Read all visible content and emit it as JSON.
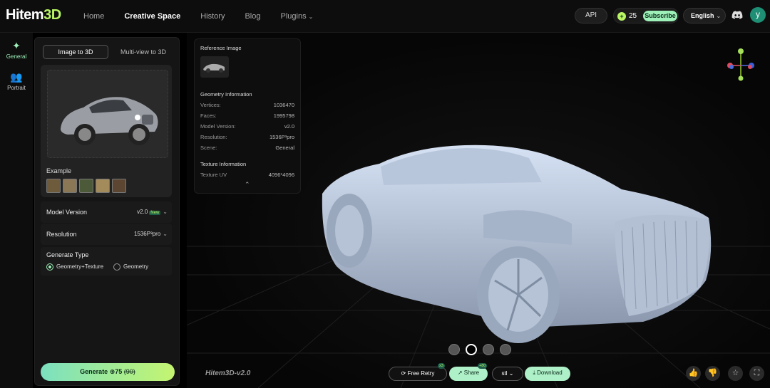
{
  "app": {
    "logo_main": "Hitem",
    "logo_accent": "3D"
  },
  "nav": {
    "items": [
      {
        "label": "Home",
        "active": false
      },
      {
        "label": "Creative Space",
        "active": true
      },
      {
        "label": "History",
        "active": false
      },
      {
        "label": "Blog",
        "active": false
      },
      {
        "label": "Plugins",
        "active": false,
        "dropdown": true
      }
    ]
  },
  "header": {
    "api_label": "API",
    "credits": "25",
    "subscribe_label": "Subscribe",
    "language": "English",
    "avatar_letter": "y"
  },
  "rail": {
    "items": [
      {
        "label": "General",
        "icon": "sparkle-icon",
        "active": true
      },
      {
        "label": "Portrait",
        "icon": "people-icon",
        "active": false
      }
    ]
  },
  "panel": {
    "tabs": [
      "Image to 3D",
      "Multi-view to 3D"
    ],
    "example_label": "Example",
    "model_version_label": "Model Version",
    "model_version_value": "v2.0",
    "new_badge": "New",
    "resolution_label": "Resolution",
    "resolution_value": "1536P³pro",
    "generate_type_label": "Generate Type",
    "generate_options": [
      "Geometry+Texture",
      "Geometry"
    ],
    "generate_label": "Generate",
    "generate_cost": "75",
    "generate_old_cost": "(90)"
  },
  "info": {
    "reference_label": "Reference Image",
    "geometry_label": "Geometry Information",
    "rows": [
      {
        "k": "Vertices:",
        "v": "1036470"
      },
      {
        "k": "Faces:",
        "v": "1995798"
      },
      {
        "k": "Model Version:",
        "v": "v2.0"
      },
      {
        "k": "Resolution:",
        "v": "1536P³pro"
      },
      {
        "k": "Scene:",
        "v": "General"
      }
    ],
    "texture_label": "Texture Information",
    "texture_row": {
      "k": "Texture UV",
      "v": "4096*4096"
    }
  },
  "viewport": {
    "watermark": "Hitem3D-v2.0",
    "free_retry_label": "Free Retry",
    "free_retry_badge": "x3",
    "share_label": "Share",
    "share_badge": "+80",
    "format_value": "stl",
    "download_label": "Download"
  },
  "colors": {
    "accent": "#b9f564",
    "mint": "#9df0b8",
    "bg": "#000000"
  }
}
